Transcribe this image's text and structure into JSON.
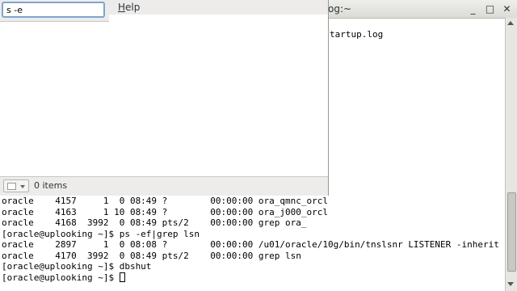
{
  "terminal": {
    "title": "og:~",
    "upper_lines": [
      "tartup.log"
    ],
    "lower_lines": [
      "oracle    4157     1  0 08:49 ?        00:00:00 ora_qmnc_orcl",
      "oracle    4163     1 10 08:49 ?        00:00:00 ora_j000_orcl",
      "oracle    4168  3992  0 08:49 pts/2    00:00:00 grep ora_",
      "[oracle@uplooking ~]$ ps -ef|grep lsn",
      "oracle    2897     1  0 08:08 ?        00:00:00 /u01/oracle/10g/bin/tnslsnr LISTENER -inherit",
      "oracle    4170  3992  0 08:49 pts/2    00:00:00 grep lsn",
      "[oracle@uplooking ~]$ dbshut"
    ],
    "prompt": "[oracle@uplooking ~]$ ",
    "controls": {
      "minimize": "_",
      "maximize": "□",
      "close": "✕"
    }
  },
  "dialog": {
    "search_value": "s -e",
    "menu_help": "Help",
    "menu_help_mnemonic": "H",
    "menu_help_rest": "elp",
    "status_count": "0 items"
  }
}
